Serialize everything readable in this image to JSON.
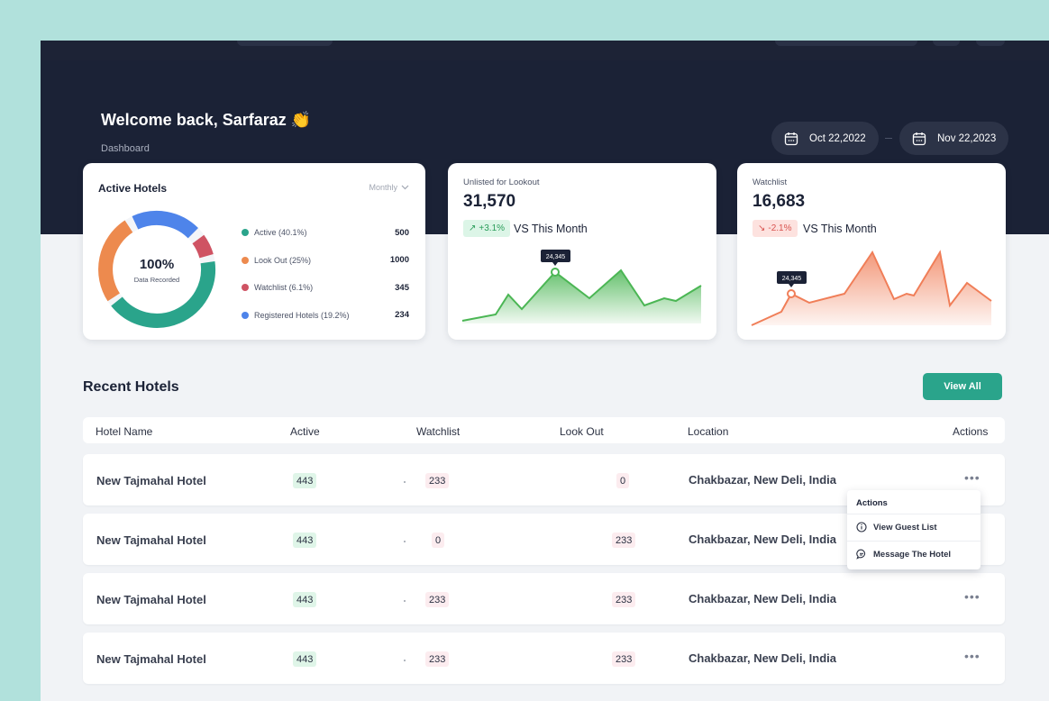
{
  "header": {
    "welcome": "Welcome back, Sarfaraz",
    "wave": "👏",
    "breadcrumb": "Dashboard",
    "date_from": "Oct 22,2022",
    "date_to": "Nov 22,2023"
  },
  "active_hotels": {
    "title": "Active Hotels",
    "period": "Monthly",
    "center_value": "100%",
    "center_label": "Data Recorded",
    "legend": [
      {
        "label": "Active (40.1%)",
        "value": "500",
        "color": "#2aa48b"
      },
      {
        "label": "Look Out (25%)",
        "value": "1000",
        "color": "#ed8a4e"
      },
      {
        "label": "Watchlist (6.1%)",
        "value": "345",
        "color": "#cf5363"
      },
      {
        "label": "Registered Hotels (19.2%)",
        "value": "234",
        "color": "#4e84ea"
      }
    ]
  },
  "unlisted": {
    "subtitle": "Unlisted for Lookout",
    "value": "31,570",
    "change": "+3.1%",
    "vs": "VS This Month",
    "tooltip": "24,345",
    "color": "#4bb654"
  },
  "watchlist": {
    "subtitle": "Watchlist",
    "value": "16,683",
    "change": "-2.1%",
    "vs": "VS This Month",
    "tooltip": "24,345",
    "color": "#f07e58"
  },
  "recent": {
    "title": "Recent Hotels",
    "view_all": "View All",
    "columns": [
      "Hotel Name",
      "Active",
      "Watchlist",
      "Look Out",
      "Location",
      "Actions"
    ],
    "rows": [
      {
        "name": "New Tajmahal Hotel",
        "active": "443",
        "watchlist": "233",
        "lookout": "0",
        "location": "Chakbazar, New Deli, India"
      },
      {
        "name": "New Tajmahal Hotel",
        "active": "443",
        "watchlist": "0",
        "lookout": "233",
        "location": "Chakbazar, New Deli, India"
      },
      {
        "name": "New Tajmahal Hotel",
        "active": "443",
        "watchlist": "233",
        "lookout": "233",
        "location": "Chakbazar, New Deli, India"
      },
      {
        "name": "New Tajmahal Hotel",
        "active": "443",
        "watchlist": "233",
        "lookout": "233",
        "location": "Chakbazar, New Deli, India"
      }
    ]
  },
  "actions_menu": {
    "title": "Actions",
    "items": [
      "View Guest List",
      "Message The Hotel"
    ]
  }
}
